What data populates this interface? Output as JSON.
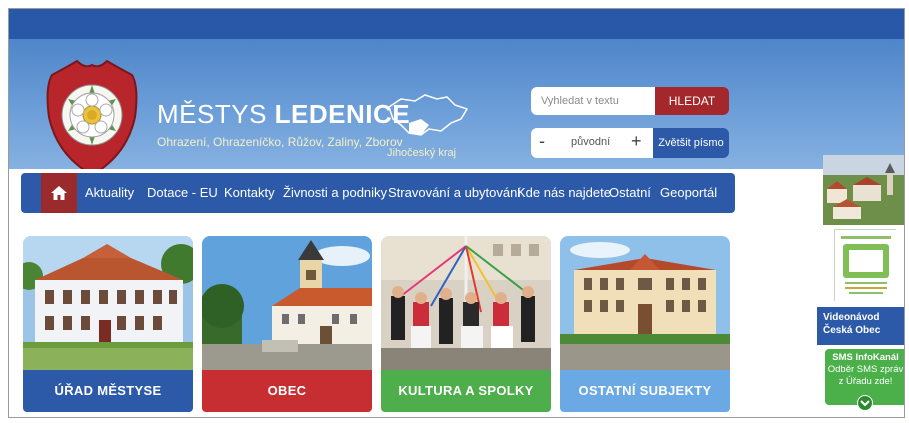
{
  "header": {
    "title_prefix": "MĚSTYS",
    "title_bold": "LEDENICE",
    "subtitle": "Ohrazení, Ohrazeníčko, Růžov, Zaliny, Zborov",
    "region_label": "Jihočeský kraj"
  },
  "search": {
    "placeholder": "Vyhledat v textu",
    "button_label": "HLEDAT"
  },
  "font_size": {
    "minus": "-",
    "value": "původní",
    "plus": "+",
    "enlarge_label": "Zvětšit písmo"
  },
  "nav": {
    "home_icon": "home-icon",
    "items": [
      {
        "label": "Aktuality"
      },
      {
        "label": "Dotace - EU"
      },
      {
        "label": "Kontakty"
      },
      {
        "label": "Živnosti a podniky"
      },
      {
        "label": "Stravování a ubytování"
      },
      {
        "label": "Kde nás najdete"
      },
      {
        "label": "Ostatní"
      },
      {
        "label": "Geoportál"
      }
    ]
  },
  "tiles": [
    {
      "label": "ÚŘAD MĚSTYSE",
      "color": "#2c5aa8"
    },
    {
      "label": "OBEC",
      "color": "#c62e32"
    },
    {
      "label": "KULTURA A SPOLKY",
      "color": "#4fae4c"
    },
    {
      "label": "OSTATNÍ SUBJEKTY",
      "color": "#6aa9e3"
    }
  ],
  "sidebar": {
    "video_line1": "Videonávod",
    "video_line2": "Česká Obec",
    "sms_title": "SMS InfoKanál",
    "sms_line1": "Odběr SMS zpráv",
    "sms_line2": "z Úřadu zde!"
  },
  "colors": {
    "top_bar": "#2a58a8",
    "header_gradient_top": "#4f86c9",
    "nav_background": "#2c5aa8",
    "nav_home": "#9a2a2b",
    "search_button": "#a4282b",
    "sms_green": "#4bb04a"
  }
}
